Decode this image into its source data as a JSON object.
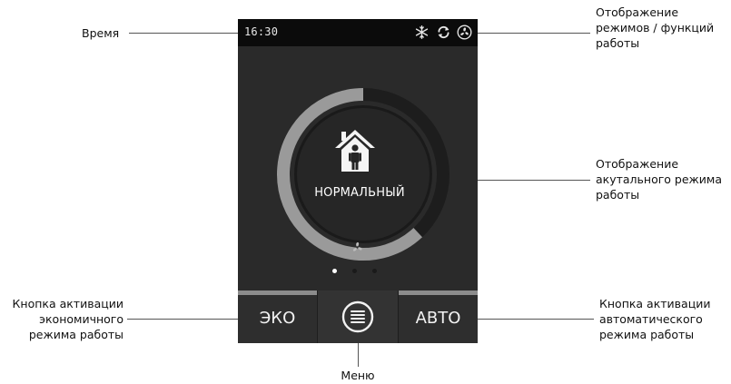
{
  "device": {
    "time": "16:30",
    "status_icons": [
      "snowflake-icon",
      "recycle-arrows-icon",
      "fan-icon"
    ],
    "mode": "НОРМАЛЬНЫЙ",
    "mode_icon": "house-person-icon",
    "progress_fraction": 0.62,
    "page_dots": {
      "count": 3,
      "active": 0
    },
    "buttons": {
      "eco": "ЭКО",
      "menu_icon": "menu-list-icon",
      "auto": "АВТО"
    },
    "colors": {
      "screen": "#2a2a2a",
      "statusbar": "#0b0b0b",
      "arc": "#9a9a9a",
      "button_bar": "#8c8c8c"
    }
  },
  "annotations": {
    "time": [
      "Время"
    ],
    "modes_functions": [
      "Отображение",
      "режимов / функций",
      "работы"
    ],
    "current_mode": [
      "Отображение",
      "акутального режима",
      "работы"
    ],
    "eco_button": [
      "Кнопка активации",
      "экономичного",
      "режима работы"
    ],
    "menu": [
      "Меню"
    ],
    "auto_button": [
      "Кнопка активации",
      "автоматического",
      "режима работы"
    ]
  }
}
